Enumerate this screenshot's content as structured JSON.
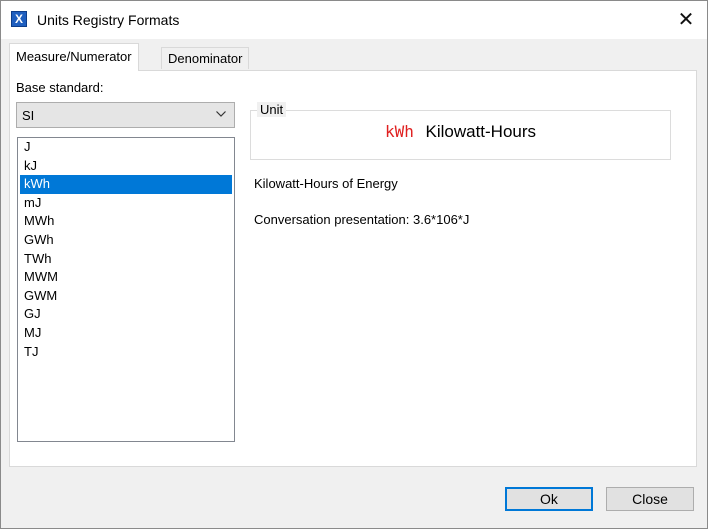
{
  "window": {
    "title": "Units Registry Formats",
    "icon_letter": "X"
  },
  "tabs": [
    {
      "label": "Measure/Numerator",
      "active": true
    },
    {
      "label": "Denominator",
      "active": false
    }
  ],
  "base_standard": {
    "label": "Base standard:",
    "value": "SI"
  },
  "units": [
    "J",
    "kJ",
    "kWh",
    "mJ",
    "MWh",
    "GWh",
    "TWh",
    "MWM",
    "GWM",
    "GJ",
    "MJ",
    "TJ"
  ],
  "selected_unit": "kWh",
  "unit_group": {
    "legend": "Unit",
    "symbol": "kWh",
    "name": "Kilowatt-Hours",
    "symbol_color": "#e02020"
  },
  "description": "Kilowatt-Hours of Energy",
  "conversion": "Conversation presentation: 3.6*106*J",
  "buttons": {
    "ok": "Ok",
    "close": "Close"
  }
}
